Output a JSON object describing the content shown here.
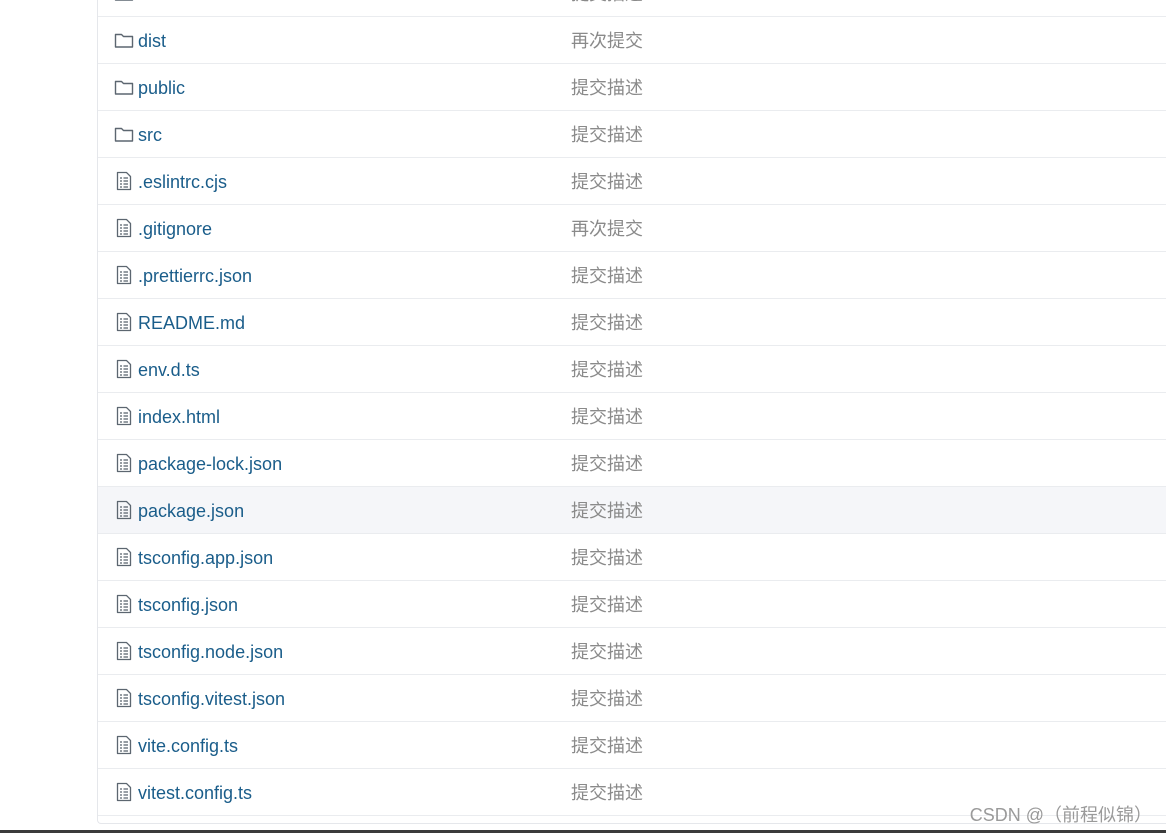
{
  "files": [
    {
      "name": "node",
      "commit": "提交描述",
      "icon": "folder-icon"
    },
    {
      "name": "dist",
      "commit": "再次提交",
      "icon": "folder-icon"
    },
    {
      "name": "public",
      "commit": "提交描述",
      "icon": "folder-icon"
    },
    {
      "name": "src",
      "commit": "提交描述",
      "icon": "folder-icon"
    },
    {
      "name": ".eslintrc.cjs",
      "commit": "提交描述",
      "icon": "file-icon"
    },
    {
      "name": ".gitignore",
      "commit": "再次提交",
      "icon": "file-icon"
    },
    {
      "name": ".prettierrc.json",
      "commit": "提交描述",
      "icon": "file-icon"
    },
    {
      "name": "README.md",
      "commit": "提交描述",
      "icon": "file-icon"
    },
    {
      "name": "env.d.ts",
      "commit": "提交描述",
      "icon": "file-icon"
    },
    {
      "name": "index.html",
      "commit": "提交描述",
      "icon": "file-icon"
    },
    {
      "name": "package-lock.json",
      "commit": "提交描述",
      "icon": "file-icon"
    },
    {
      "name": "package.json",
      "commit": "提交描述",
      "icon": "file-icon",
      "hovered": true
    },
    {
      "name": "tsconfig.app.json",
      "commit": "提交描述",
      "icon": "file-icon"
    },
    {
      "name": "tsconfig.json",
      "commit": "提交描述",
      "icon": "file-icon"
    },
    {
      "name": "tsconfig.node.json",
      "commit": "提交描述",
      "icon": "file-icon"
    },
    {
      "name": "tsconfig.vitest.json",
      "commit": "提交描述",
      "icon": "file-icon"
    },
    {
      "name": "vite.config.ts",
      "commit": "提交描述",
      "icon": "file-icon"
    },
    {
      "name": "vitest.config.ts",
      "commit": "提交描述",
      "icon": "file-icon"
    }
  ],
  "watermark": "CSDN @（前程似锦）",
  "colors": {
    "link": "#1a5d8a",
    "commit_text": "#8a8a8a",
    "row_border": "#eaecef",
    "hover_bg": "#f5f6f9",
    "icon_stroke": "#5c6670"
  }
}
